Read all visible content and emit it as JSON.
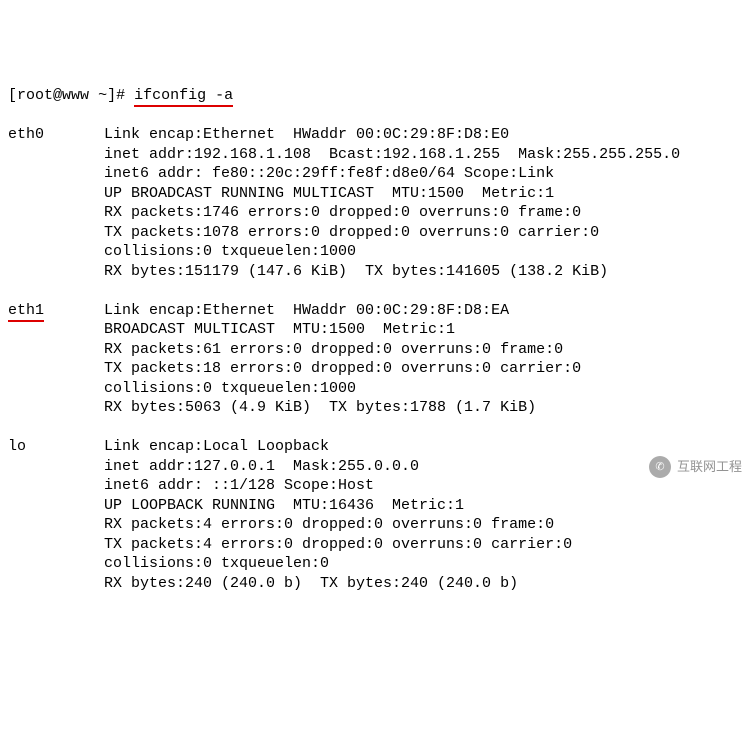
{
  "prompt": {
    "user": "root",
    "host": "www",
    "path": "~",
    "symbol": "#",
    "command": "ifconfig -a"
  },
  "interfaces": [
    {
      "name": "eth0",
      "highlighted": false,
      "lines": [
        "Link encap:Ethernet  HWaddr 00:0C:29:8F:D8:E0",
        "inet addr:192.168.1.108  Bcast:192.168.1.255  Mask:255.255.255.0",
        "inet6 addr: fe80::20c:29ff:fe8f:d8e0/64 Scope:Link",
        "UP BROADCAST RUNNING MULTICAST  MTU:1500  Metric:1",
        "RX packets:1746 errors:0 dropped:0 overruns:0 frame:0",
        "TX packets:1078 errors:0 dropped:0 overruns:0 carrier:0",
        "collisions:0 txqueuelen:1000",
        "RX bytes:151179 (147.6 KiB)  TX bytes:141605 (138.2 KiB)"
      ]
    },
    {
      "name": "eth1",
      "highlighted": true,
      "lines": [
        "Link encap:Ethernet  HWaddr 00:0C:29:8F:D8:EA",
        "BROADCAST MULTICAST  MTU:1500  Metric:1",
        "RX packets:61 errors:0 dropped:0 overruns:0 frame:0",
        "TX packets:18 errors:0 dropped:0 overruns:0 carrier:0",
        "collisions:0 txqueuelen:1000",
        "RX bytes:5063 (4.9 KiB)  TX bytes:1788 (1.7 KiB)"
      ]
    },
    {
      "name": "lo",
      "highlighted": false,
      "lines": [
        "Link encap:Local Loopback",
        "inet addr:127.0.0.1  Mask:255.0.0.0",
        "inet6 addr: ::1/128 Scope:Host",
        "UP LOOPBACK RUNNING  MTU:16436  Metric:1",
        "RX packets:4 errors:0 dropped:0 overruns:0 frame:0",
        "TX packets:4 errors:0 dropped:0 overruns:0 carrier:0",
        "collisions:0 txqueuelen:0",
        "RX bytes:240 (240.0 b)  TX bytes:240 (240.0 b)"
      ]
    }
  ],
  "watermark": {
    "text": "互联网工程"
  }
}
